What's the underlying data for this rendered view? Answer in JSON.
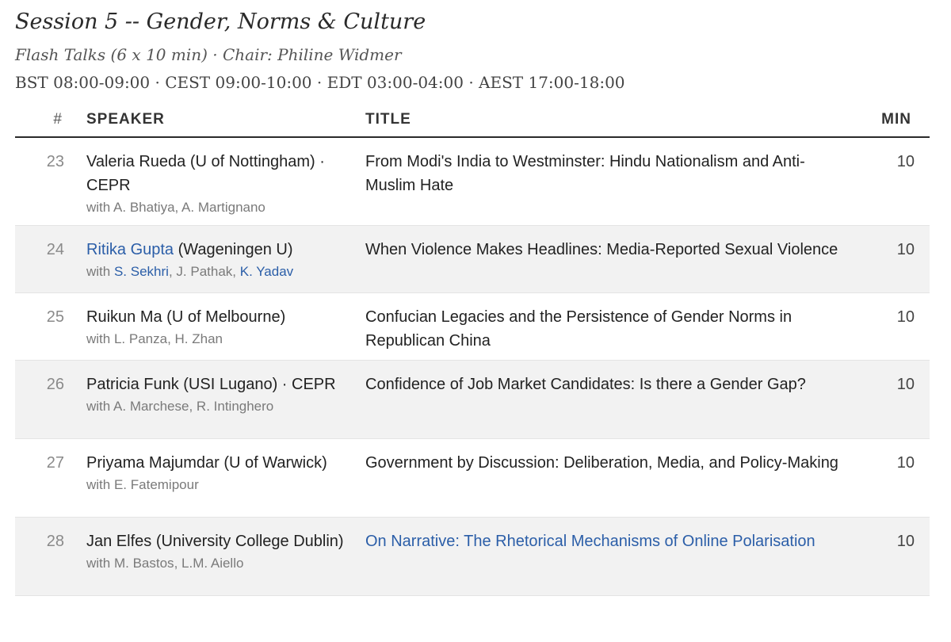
{
  "session": {
    "title": "Session 5 -- Gender, Norms & Culture",
    "subtitle": "Flash Talks (6 x 10 min) · Chair: Philine Widmer",
    "times": "BST 08:00-09:00 · CEST 09:00-10:00 · EDT 03:00-04:00 · AEST 17:00-18:00"
  },
  "table": {
    "headers": {
      "num": "#",
      "speaker": "SPEAKER",
      "title": "TITLE",
      "min": "MIN"
    },
    "rows": [
      {
        "num": "23",
        "speaker_name": "Valeria Rueda",
        "speaker_affil": " (U of Nottingham) · CEPR",
        "with": "with ",
        "coauthors": [
          "A. Bhatiya",
          "A. Martignano"
        ],
        "title": "From Modi's India to Westminster: Hindu Nationalism and Anti-Muslim Hate",
        "min": "10"
      },
      {
        "num": "24",
        "speaker_name": "Ritika Gupta",
        "speaker_affil": " (Wageningen U)",
        "with": "with ",
        "coauthors": [
          "S. Sekhri",
          "J. Pathak",
          "K. Yadav"
        ],
        "title": "When Violence Makes Headlines: Media-Reported Sexual Violence",
        "min": "10"
      },
      {
        "num": "25",
        "speaker_name": "Ruikun Ma",
        "speaker_affil": " (U of Melbourne)",
        "with": "with ",
        "coauthors": [
          "L. Panza",
          "H. Zhan"
        ],
        "title": "Confucian Legacies and the Persistence of Gender Norms in Republican China",
        "min": "10"
      },
      {
        "num": "26",
        "speaker_name": "Patricia Funk",
        "speaker_affil": " (USI Lugano) · CEPR",
        "with": "with ",
        "coauthors": [
          "A. Marchese",
          "R. Intinghero"
        ],
        "title": "Confidence of Job Market Candidates: Is there a Gender Gap?",
        "min": "10"
      },
      {
        "num": "27",
        "speaker_name": "Priyama Majumdar",
        "speaker_affil": " (U of Warwick)",
        "with": "with ",
        "coauthors": [
          "E. Fatemipour"
        ],
        "title": "Government by Discussion: Deliberation, Media, and Policy-Making",
        "min": "10"
      },
      {
        "num": "28",
        "speaker_name": "Jan Elfes",
        "speaker_affil": " (University College Dublin)",
        "with": "with ",
        "coauthors": [
          "M. Bastos",
          "L.M. Aiello"
        ],
        "title": "On Narrative: The Rhetorical Mechanisms of Online Polarisation",
        "min": "10"
      }
    ]
  },
  "colors": {
    "link": "#2b5ea8",
    "row_shade": "#f2f2f2",
    "muted_text": "#7a7a7a"
  }
}
